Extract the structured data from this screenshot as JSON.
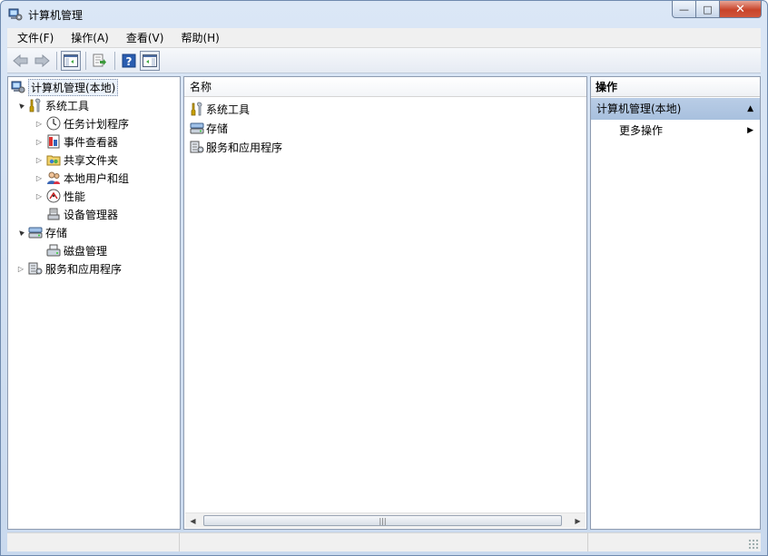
{
  "window": {
    "title": "计算机管理",
    "controls": {
      "minimize": "—",
      "maximize": "□",
      "close": "✕"
    }
  },
  "menu": [
    "文件(F)",
    "操作(A)",
    "查看(V)",
    "帮助(H)"
  ],
  "toolbar": [
    "back-arrow-icon",
    "forward-arrow-icon",
    "show-hide-tree-icon",
    "export-list-icon",
    "help-icon",
    "show-hide-action-pane-icon"
  ],
  "tree": {
    "root": "计算机管理(本地)",
    "items": [
      {
        "label": "系统工具",
        "level": 1,
        "expander": "▲",
        "icon": "tools-icon"
      },
      {
        "label": "任务计划程序",
        "level": 2,
        "expander": "▷",
        "icon": "clock-icon"
      },
      {
        "label": "事件查看器",
        "level": 2,
        "expander": "▷",
        "icon": "event-viewer-icon"
      },
      {
        "label": "共享文件夹",
        "level": 2,
        "expander": "▷",
        "icon": "shared-folder-icon"
      },
      {
        "label": "本地用户和组",
        "level": 2,
        "expander": "▷",
        "icon": "users-icon"
      },
      {
        "label": "性能",
        "level": 2,
        "expander": "▷",
        "icon": "performance-icon"
      },
      {
        "label": "设备管理器",
        "level": 2,
        "expander": "",
        "icon": "device-manager-icon"
      },
      {
        "label": "存储",
        "level": 1,
        "expander": "▲",
        "icon": "storage-icon"
      },
      {
        "label": "磁盘管理",
        "level": 2,
        "expander": "",
        "icon": "disk-icon"
      },
      {
        "label": "服务和应用程序",
        "level": 1,
        "expander": "▷",
        "icon": "services-icon"
      }
    ]
  },
  "center": {
    "column_header": "名称",
    "rows": [
      {
        "label": "系统工具",
        "icon": "tools-icon"
      },
      {
        "label": "存储",
        "icon": "storage-icon"
      },
      {
        "label": "服务和应用程序",
        "icon": "services-icon"
      }
    ],
    "scroll": {
      "left": "◀",
      "right": "▶",
      "thumb_grip": "|||"
    }
  },
  "actions": {
    "header": "操作",
    "group": "计算机管理(本地)",
    "group_arrow": "▲",
    "items": [
      {
        "label": "更多操作",
        "arrow": "▶"
      }
    ]
  }
}
